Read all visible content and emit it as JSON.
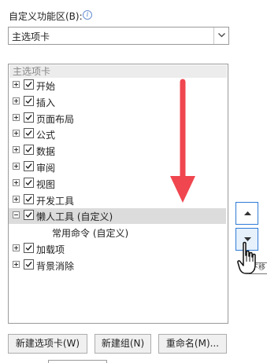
{
  "header": {
    "label": "自定义功能区(B):"
  },
  "dropdown": {
    "value": "主选项卡"
  },
  "tree": {
    "header": "主选项卡",
    "items": [
      {
        "label": "开始",
        "expanded": false,
        "checked": true
      },
      {
        "label": "插入",
        "expanded": false,
        "checked": true
      },
      {
        "label": "页面布局",
        "expanded": false,
        "checked": true
      },
      {
        "label": "公式",
        "expanded": false,
        "checked": true
      },
      {
        "label": "数据",
        "expanded": false,
        "checked": true
      },
      {
        "label": "审阅",
        "expanded": false,
        "checked": true
      },
      {
        "label": "视图",
        "expanded": false,
        "checked": true
      },
      {
        "label": "开发工具",
        "expanded": false,
        "checked": true
      },
      {
        "label": "懒人工具 (自定义)",
        "expanded": true,
        "checked": true,
        "selected": true
      },
      {
        "label": "常用命令 (自定义)",
        "child": true
      },
      {
        "label": "加载项",
        "expanded": false,
        "checked": true
      },
      {
        "label": "背景消除",
        "expanded": false,
        "checked": true
      }
    ]
  },
  "buttons": {
    "new_tab": "新建选项卡(W)",
    "new_group": "新建组(N)",
    "rename": "重命名(M)..."
  },
  "tooltip_fragment": "下移",
  "colors": {
    "annotation_arrow": "#f0464f",
    "side_button_border": "#2e7bd6"
  },
  "icons": [
    "info-icon",
    "dropdown-arrow-icon",
    "expand-icon",
    "collapse-icon",
    "checkmark-icon",
    "move-up-icon",
    "move-down-icon",
    "hand-cursor-icon",
    "annotation-arrow-icon"
  ]
}
